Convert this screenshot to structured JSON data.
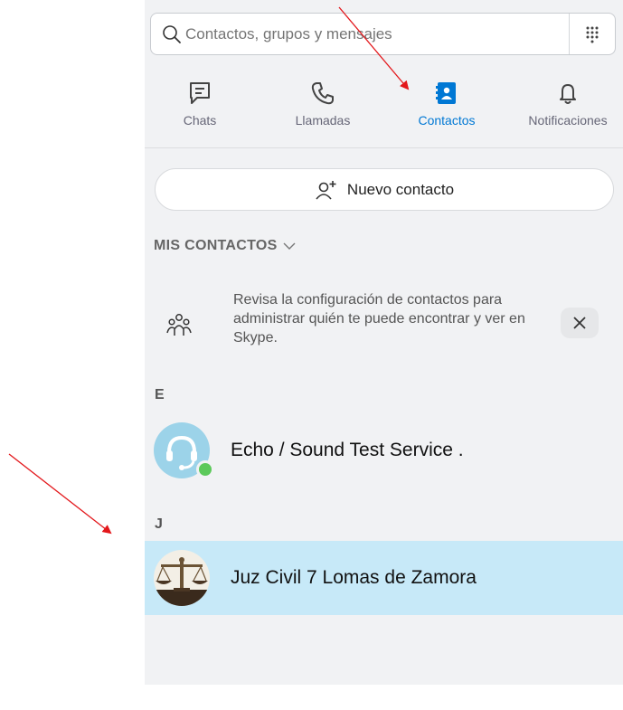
{
  "search": {
    "placeholder": "Contactos, grupos y mensajes"
  },
  "tabs": [
    {
      "label": "Chats",
      "icon": "chat-icon"
    },
    {
      "label": "Llamadas",
      "icon": "phone-icon"
    },
    {
      "label": "Contactos",
      "icon": "contacts-icon",
      "active": true
    },
    {
      "label": "Notificaciones",
      "icon": "bell-icon"
    }
  ],
  "new_contact_label": "Nuevo contacto",
  "section": {
    "title": "MIS CONTACTOS"
  },
  "notice": {
    "text": "Revisa la configuración de contactos para administrar quién te puede encontrar y ver en Skype."
  },
  "groups": [
    {
      "letter": "E",
      "contact": {
        "name": "Echo / Sound Test Service .",
        "online": true
      }
    },
    {
      "letter": "J",
      "contact": {
        "name": "Juz Civil 7 Lomas de Zamora",
        "selected": true
      }
    }
  ],
  "colors": {
    "accent": "#0078d4",
    "selected_row": "#c7e9f8",
    "annotation_arrow": "#e3171b",
    "online": "#5cc95a"
  }
}
